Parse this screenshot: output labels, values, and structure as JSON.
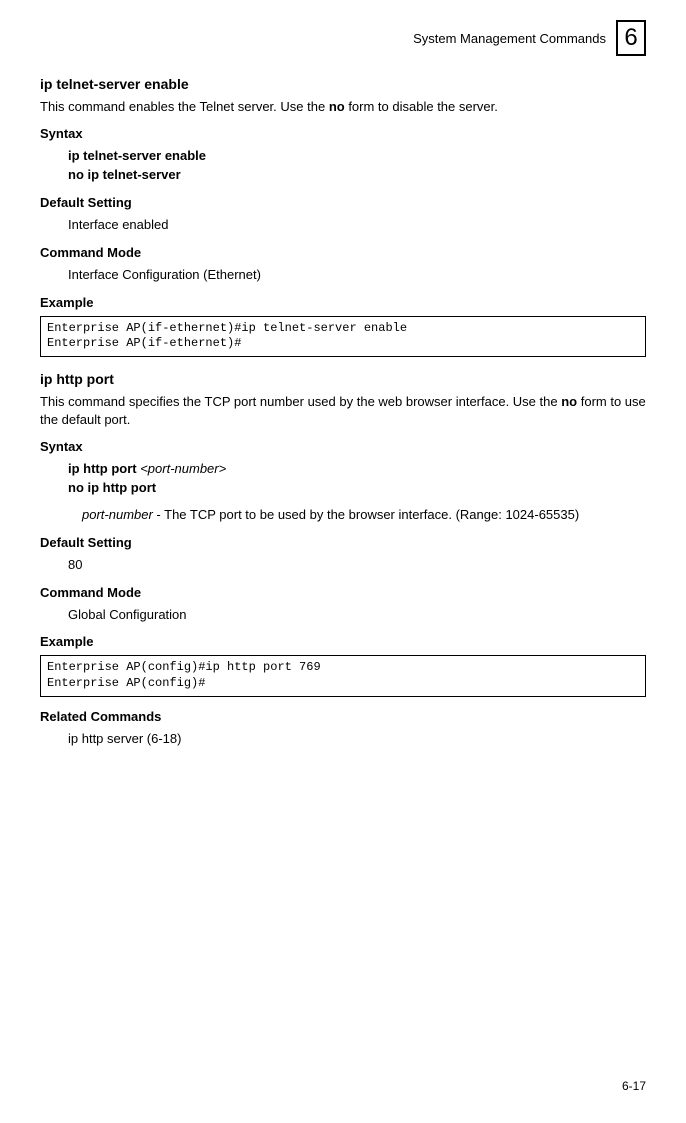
{
  "header": {
    "title": "System Management Commands",
    "chapter": "6"
  },
  "cmd1": {
    "title": "ip telnet-server enable",
    "desc_pre": "This command enables the Telnet server. Use the ",
    "desc_bold": "no",
    "desc_post": " form to disable the server.",
    "syntax_label": "Syntax",
    "syntax_line1": "ip telnet-server enable",
    "syntax_line2": "no ip telnet-server",
    "default_label": "Default Setting",
    "default_value": "Interface enabled",
    "mode_label": "Command Mode",
    "mode_value": "Interface Configuration (Ethernet)",
    "example_label": "Example",
    "example_code": "Enterprise AP(if-ethernet)#ip telnet-server enable\nEnterprise AP(if-ethernet)#"
  },
  "cmd2": {
    "title": "ip http port",
    "desc_pre": "This command specifies the TCP port number used by the web browser interface. Use the ",
    "desc_bold": "no",
    "desc_post": " form to use the default port.",
    "syntax_label": "Syntax",
    "syntax_bold1": "ip http port ",
    "syntax_italic1": "<port-number>",
    "syntax_line2": "no ip http port",
    "param_italic": "port-number",
    "param_text": " - The TCP port to be used by the browser interface. (Range: 1024-65535)",
    "default_label": "Default Setting",
    "default_value": "80",
    "mode_label": "Command Mode",
    "mode_value": "Global Configuration",
    "example_label": "Example",
    "example_code": "Enterprise AP(config)#ip http port 769\nEnterprise AP(config)#",
    "related_label": "Related Commands",
    "related_value": "ip http server (6-18)"
  },
  "footer": {
    "page": "6-17"
  }
}
